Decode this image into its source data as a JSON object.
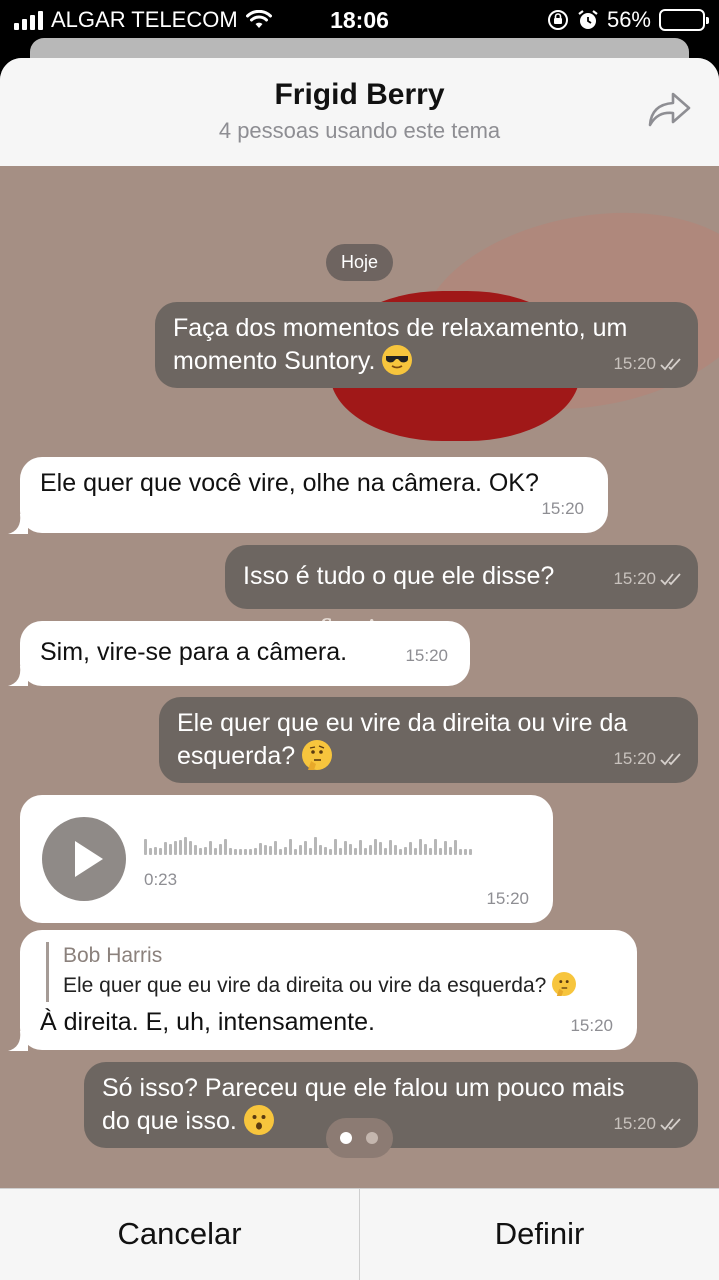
{
  "status_bar": {
    "carrier": "ALGAR TELECOM",
    "time": "18:06",
    "battery_percent": "56%",
    "battery_level": 0.56
  },
  "theme": {
    "title": "Frigid Berry",
    "subtitle": "4 pessoas usando este tema"
  },
  "chat": {
    "date_label": "Hoje",
    "messages": [
      {
        "dir": "out",
        "line1": "Faça dos momentos de relaxamento, um",
        "line2": "momento Suntory.",
        "emoji": "sunglasses-emoji",
        "time": "15:20"
      },
      {
        "dir": "in",
        "text": "Ele quer que você vire, olhe na câmera. OK?",
        "time": "15:20"
      },
      {
        "dir": "out",
        "text": "Isso é tudo o que ele disse?",
        "time": "15:20"
      },
      {
        "dir": "in",
        "text": "Sim, vire-se para a câmera.",
        "time": "15:20"
      },
      {
        "dir": "out",
        "line1": "Ele quer que eu vire da direita ou vire da",
        "line2": "esquerda?",
        "emoji": "thinking-emoji",
        "time": "15:20"
      },
      {
        "dir": "in",
        "type": "voice",
        "duration": "0:23",
        "time": "15:20"
      },
      {
        "dir": "in",
        "reply_name": "Bob Harris",
        "reply_text": "Ele quer que eu vire da direita ou vire da esquerda?",
        "reply_emoji": "thinking-emoji",
        "text": "À direita. E, uh, intensamente.",
        "time": "15:20"
      },
      {
        "dir": "out",
        "line1": "Só isso? Pareceu que ele falou um pouco mais",
        "line2": "do que isso.",
        "emoji": "hushed-emoji",
        "time": "15:20"
      }
    ],
    "page_dots": {
      "count": 2,
      "active": 1
    }
  },
  "footer": {
    "cancel_label": "Cancelar",
    "set_label": "Definir"
  },
  "colors": {
    "wallpaper": "#a58f84",
    "outgoing_bubble": "#6d6661",
    "incoming_bubble": "#ffffff"
  }
}
